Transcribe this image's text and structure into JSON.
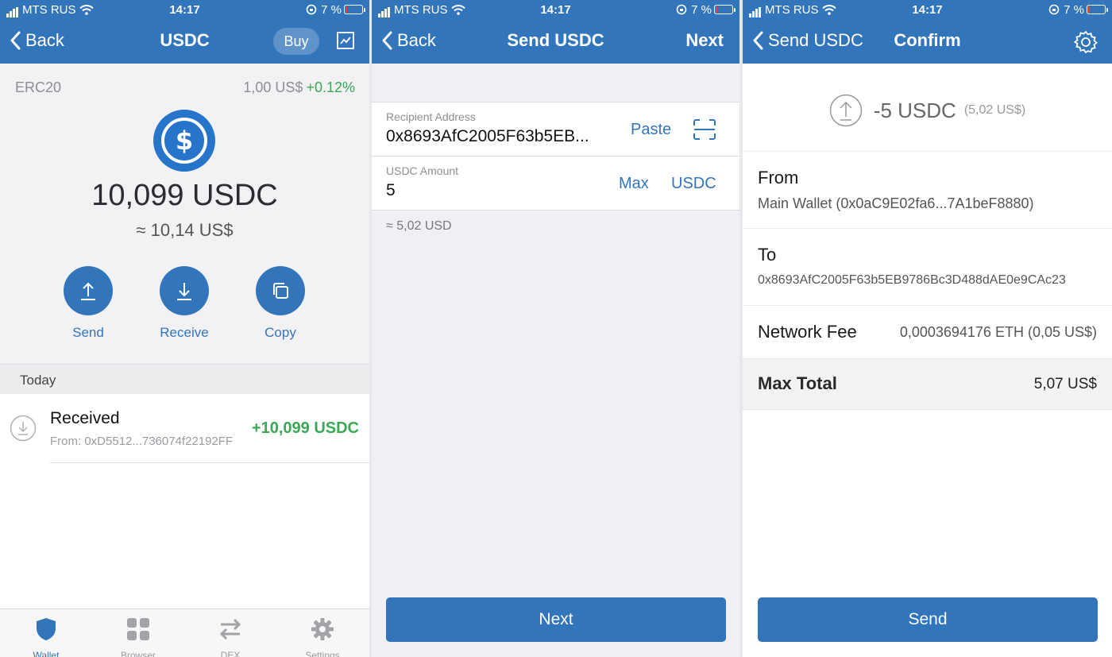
{
  "status": {
    "carrier": "MTS RUS",
    "time": "14:17",
    "battery": "7 %"
  },
  "colors": {
    "brand_blue": "#3375bb",
    "usdc_blue": "#2775ca",
    "positive_green": "#3aa855"
  },
  "wallet_screen": {
    "back_label": "Back",
    "title": "USDC",
    "buy_label": "Buy",
    "chart_icon": "line-chart-icon",
    "network": "ERC20",
    "price": "1,00 US$",
    "price_change": "+0.12%",
    "balance": "10,099 USDC",
    "balance_fiat": "≈ 10,14 US$",
    "actions": [
      {
        "label": "Send",
        "icon": "arrow-up-icon"
      },
      {
        "label": "Receive",
        "icon": "arrow-down-icon"
      },
      {
        "label": "Copy",
        "icon": "copy-icon"
      }
    ],
    "section_header": "Today",
    "transactions": [
      {
        "title": "Received",
        "from": "From: 0xD5512...736074f22192FF",
        "amount": "+10,099 USDC"
      }
    ],
    "tabs": [
      {
        "label": "Wallet",
        "icon": "shield-icon",
        "active": true
      },
      {
        "label": "Browser",
        "icon": "grid-icon",
        "active": false
      },
      {
        "label": "DEX",
        "icon": "swap-arrows-icon",
        "active": false
      },
      {
        "label": "Settings",
        "icon": "gear-icon",
        "active": false
      }
    ]
  },
  "send_screen": {
    "back_label": "Back",
    "title": "Send USDC",
    "next_label": "Next",
    "recipient_label": "Recipient Address",
    "recipient_value": "0x8693AfC2005F63b5EB...",
    "paste_label": "Paste",
    "amount_label": "USDC Amount",
    "amount_value": "5",
    "max_label": "Max",
    "currency_label": "USDC",
    "approx_value": "≈ 5,02  USD",
    "next_button": "Next"
  },
  "confirm_screen": {
    "back_label": "Send USDC",
    "title": "Confirm",
    "amount": "-5 USDC",
    "amount_fiat": "(5,02 US$)",
    "from_label": "From",
    "from_value": "Main Wallet (0x0aC9E02fa6...7A1beF8880)",
    "to_label": "To",
    "to_value": "0x8693AfC2005F63b5EB9786Bc3D488dAE0e9CAc23",
    "fee_label": "Network Fee",
    "fee_value": "0,0003694176 ETH (0,05 US$)",
    "total_label": "Max Total",
    "total_value": "5,07 US$",
    "send_button": "Send"
  }
}
